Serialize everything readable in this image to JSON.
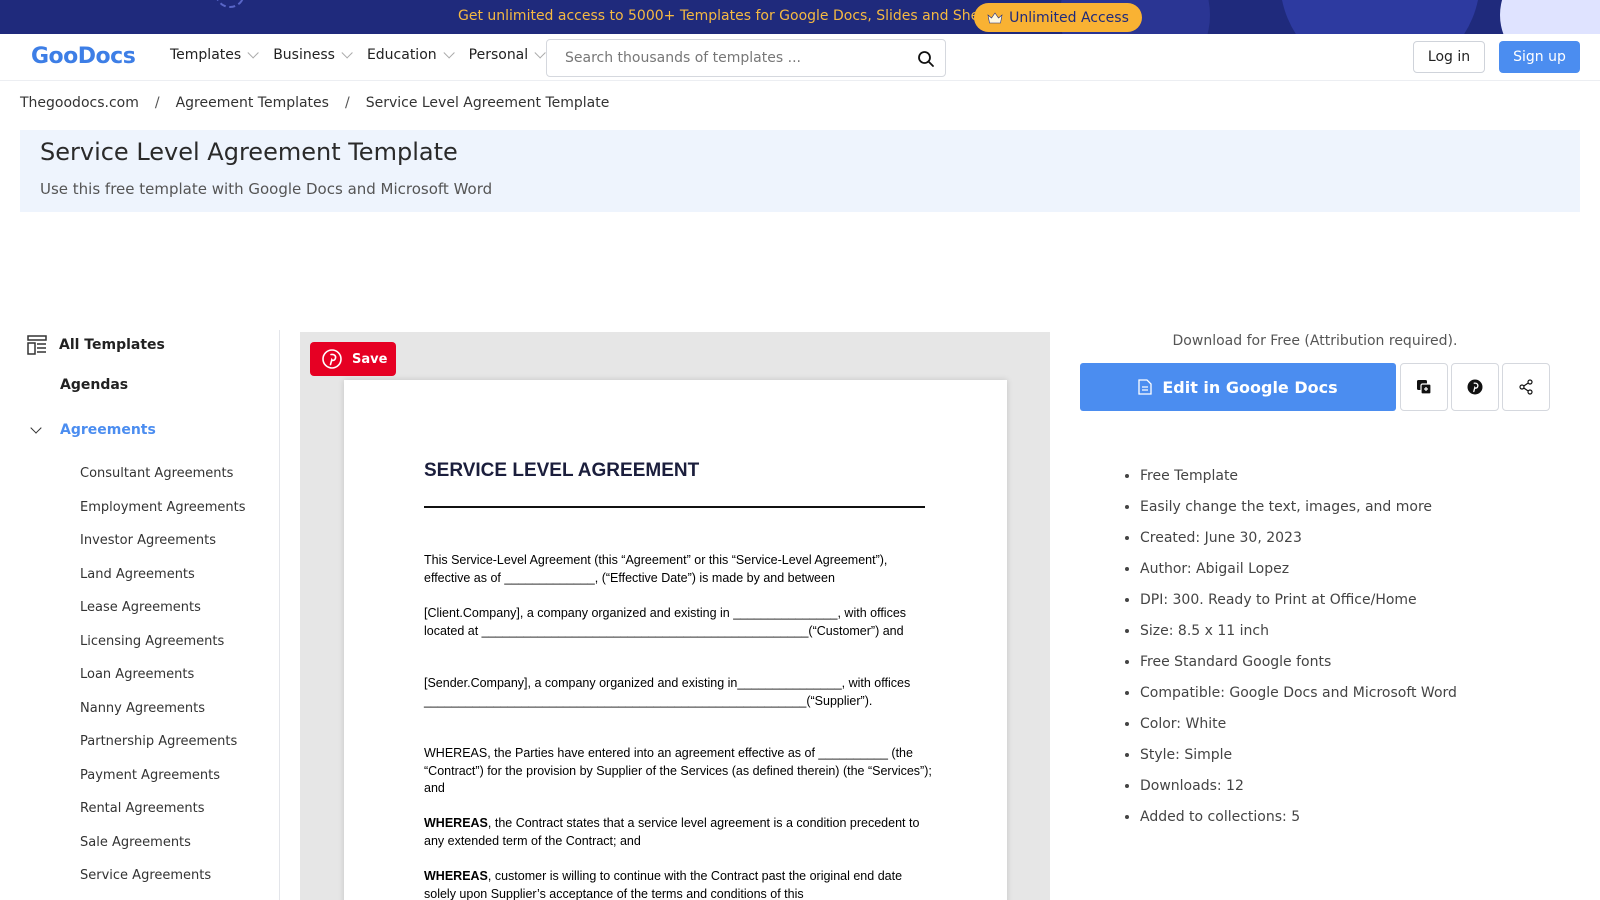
{
  "promo": {
    "text": "Get unlimited access to 5000+ Templates for Google Docs, Slides and Sheets",
    "button_label": "Unlimited Access"
  },
  "header": {
    "logo": "GooDocs",
    "nav": [
      {
        "label": "Templates"
      },
      {
        "label": "Business"
      },
      {
        "label": "Education"
      },
      {
        "label": "Personal"
      }
    ],
    "search_placeholder": "Search thousands of templates ...",
    "login_label": "Log in",
    "signup_label": "Sign up"
  },
  "breadcrumb": {
    "items": [
      "Thegoodocs.com",
      "Agreement Templates",
      "Service Level Agreement Template"
    ],
    "separator": "/"
  },
  "title": {
    "heading": "Service Level Agreement Template",
    "subtitle": "Use this free template with Google Docs and Microsoft Word"
  },
  "sidebar": {
    "all_label": "All Templates",
    "top_items": [
      "Agendas"
    ],
    "active_label": "Agreements",
    "sub_items": [
      "Consultant Agreements",
      "Employment Agreements",
      "Investor Agreements",
      "Land Agreements",
      "Lease Agreements",
      "Licensing Agreements",
      "Loan Agreements",
      "Nanny Agreements",
      "Partnership Agreements",
      "Payment Agreements",
      "Rental Agreements",
      "Sale Agreements",
      "Service Agreements"
    ]
  },
  "preview": {
    "save_label": "Save",
    "doc_title": "SERVICE LEVEL AGREEMENT",
    "paragraphs": [
      {
        "bold": "",
        "text": "This Service-Level Agreement (this “Agreement” or this “Service-Level Agreement”), effective as of _____________, (“Effective Date”) is made by and between"
      },
      {
        "bold": "",
        "text": "[Client.Company], a company organized and existing in _______________, with offices located at _______________________________________________(“Customer”) and"
      },
      {
        "bold": "",
        "text": "[Sender.Company], a company organized and existing in_______________, with offices _______________________________________________________(“Supplier”)."
      },
      {
        "bold": "",
        "text": "WHEREAS, the Parties have entered into an agreement effective as of __________ (the “Contract”) for the provision by Supplier of the Services (as defined therein) (the “Services”); and"
      },
      {
        "bold": "WHEREAS",
        "text": ", the Contract states that a service level agreement is a condition precedent to any extended term of the Contract; and"
      },
      {
        "bold": "WHEREAS",
        "text": ", customer is willing to continue with the Contract past the original end date solely upon Supplier’s acceptance of the terms and conditions of this"
      }
    ]
  },
  "panel": {
    "download_text": "Download for Free (Attribution required).",
    "edit_label": "Edit in Google Docs",
    "info": [
      "Free Template",
      "Easily change the text, images, and more",
      "Created: June 30, 2023",
      "Author: Abigail Lopez",
      "DPI: 300. Ready to Print at Office/Home",
      "Size: 8.5 x 11 inch",
      "Free Standard Google fonts",
      "Compatible: Google Docs and Microsoft Word",
      "Color: White",
      "Style: Simple",
      "Downloads: 12",
      "Added to collections: 5"
    ]
  },
  "colors": {
    "brand_blue": "#4b8df0",
    "banner_navy": "#1f2a7c",
    "banner_gold": "#f9b233",
    "pinterest_red": "#e60023"
  }
}
